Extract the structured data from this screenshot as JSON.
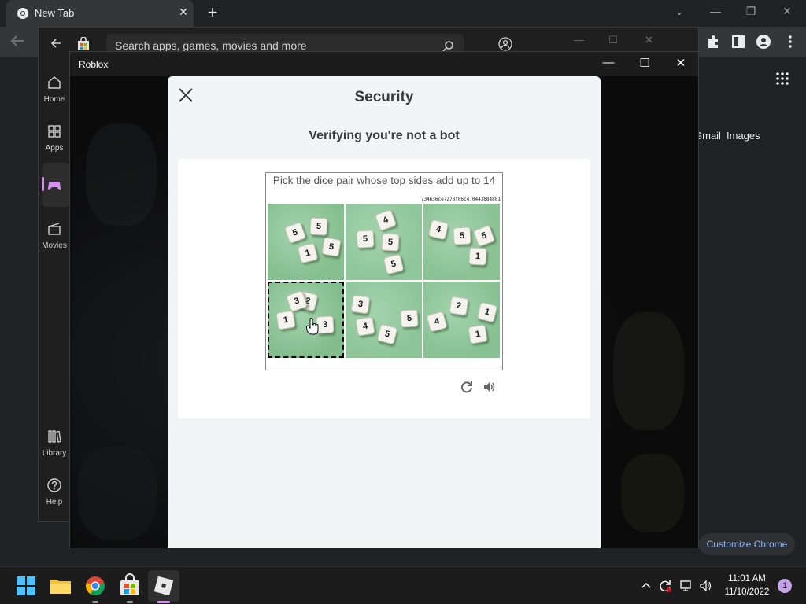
{
  "chrome": {
    "tab_title": "New Tab",
    "tab_close": "✕",
    "new_tab": "+",
    "minimize": "—",
    "restore": "❐",
    "close": "✕",
    "collapse": "⌄",
    "ntp_links": {
      "gmail": "Gmail",
      "images": "Images"
    },
    "customize_label": "Customize Chrome"
  },
  "store": {
    "search_placeholder": "Search apps, games, movies and more",
    "nav": [
      {
        "label": "Home",
        "icon": "home-icon"
      },
      {
        "label": "Apps",
        "icon": "apps-icon"
      },
      {
        "label": "",
        "icon": "gaming-icon"
      },
      {
        "label": "Movies",
        "icon": "movies-icon"
      },
      {
        "label": "Library",
        "icon": "library-icon"
      },
      {
        "label": "Help",
        "icon": "help-icon"
      }
    ]
  },
  "roblox": {
    "window_title": "Roblox",
    "minimize": "—",
    "maximize": "☐",
    "close": "✕"
  },
  "modal": {
    "title": "Security",
    "subtitle": "Verifying you're not a bot",
    "captcha": {
      "prompt": "Pick the dice pair whose top sides add up to 14",
      "code": "734636ce7278f06c4.0443884801",
      "tiles": [
        {
          "dice": [
            "5",
            "5",
            "1",
            "5"
          ],
          "selected": false
        },
        {
          "dice": [
            "5",
            "4",
            "5",
            "5"
          ],
          "selected": false
        },
        {
          "dice": [
            "4",
            "5",
            "5",
            "1"
          ],
          "selected": false
        },
        {
          "dice": [
            "1",
            "2",
            "3",
            "3"
          ],
          "selected": true
        },
        {
          "dice": [
            "3",
            "4",
            "5",
            "5"
          ],
          "selected": false
        },
        {
          "dice": [
            "4",
            "2",
            "1",
            "1"
          ],
          "selected": false
        }
      ],
      "refresh_icon": "refresh-icon",
      "audio_icon": "speaker-icon"
    }
  },
  "taskbar": {
    "apps": [
      "start-icon",
      "file-explorer-icon",
      "chrome-icon",
      "microsoft-store-icon",
      "roblox-icon"
    ],
    "clock_time": "11:01 AM",
    "clock_date": "11/10/2022",
    "notification_count": "1",
    "accent_color": "#d58ff0"
  }
}
